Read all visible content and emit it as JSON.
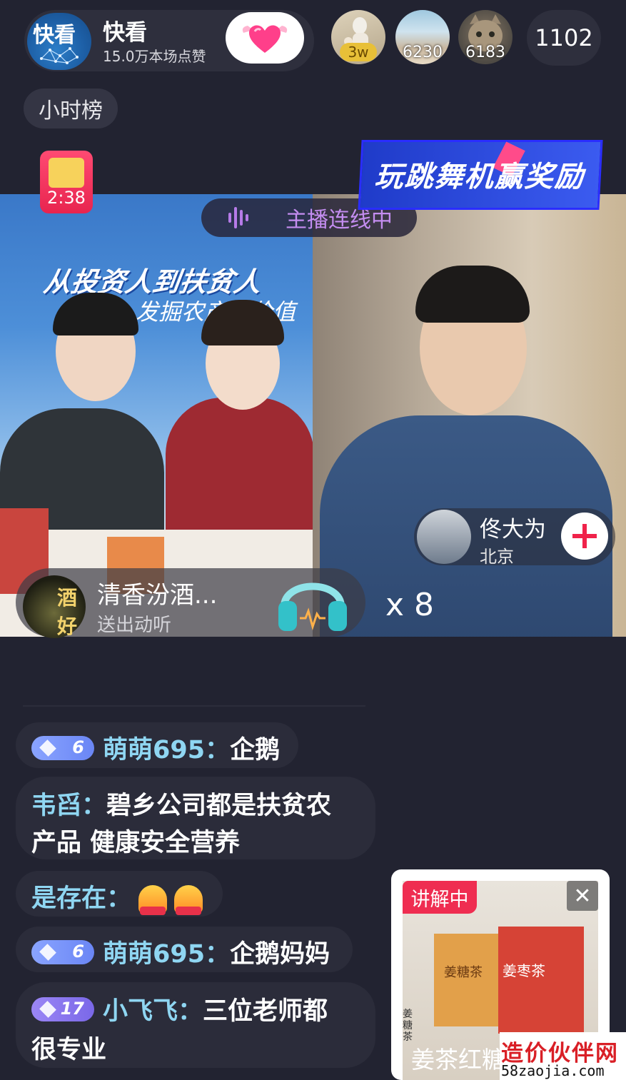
{
  "host": {
    "logo_text": "快看",
    "name": "快看",
    "likes": "15.0万本场点赞"
  },
  "viewers": [
    {
      "count": "3w"
    },
    {
      "count": "6230"
    },
    {
      "count": "6183"
    }
  ],
  "viewer_total": "1102",
  "hour_rank_label": "小时榜",
  "timer": "2:38",
  "banner_text": "玩跳舞机赢奖励",
  "live_link_status": "主播连线中",
  "video_left": {
    "slogan": "从投资人到扶贫人",
    "slogan_sub": "发掘农产品价值"
  },
  "guest": {
    "name": "佟大为",
    "location": "北京"
  },
  "gift": {
    "sender": "清香汾酒...",
    "avatar_text": "酒好",
    "description": "送出动听",
    "count": "x 8"
  },
  "chat": [
    {
      "level": "6",
      "user": "萌萌695：",
      "message": "企鹅"
    },
    {
      "user": "韦舀：",
      "message": "碧乡公司都是扶贫农",
      "message_cont": "产品  健康安全营养"
    },
    {
      "user": "是存在：",
      "flames": 2
    },
    {
      "level": "6",
      "user": "萌萌695：",
      "message": "企鹅妈妈"
    },
    {
      "level": "17",
      "user": "小飞飞：",
      "message": "三位老师都",
      "message_cont": "很专业"
    }
  ],
  "product": {
    "tag": "讲解中",
    "close": "✕",
    "caption": "姜茶红糖",
    "box1_label": "姜糖茶",
    "box2_label": "姜枣茶",
    "side_label": "姜糖茶"
  },
  "watermark": {
    "line1": "造价伙伴网",
    "line2": "58zaojia.com"
  },
  "colors": {
    "background": "#222331",
    "username": "#8fd6f2",
    "accent_pink": "#ef2d51",
    "live_link_text": "#c48df0"
  }
}
